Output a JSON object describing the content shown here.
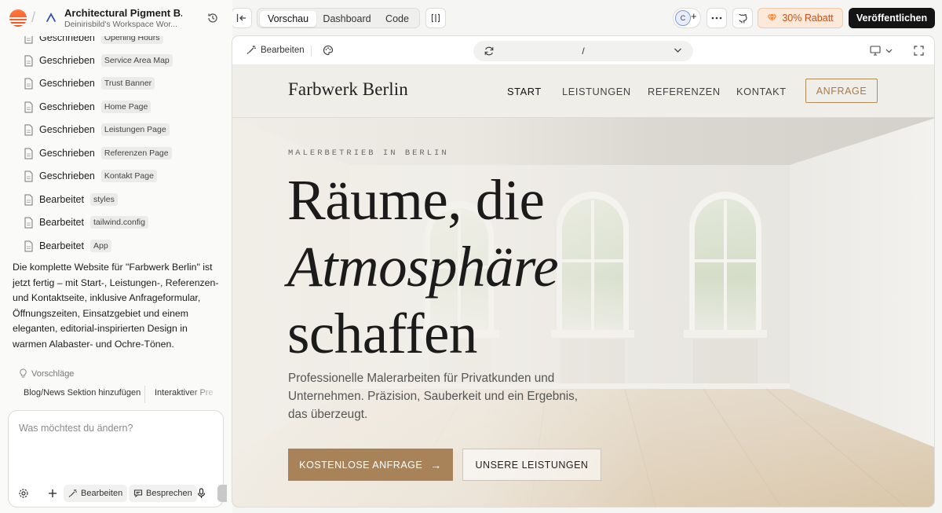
{
  "sidebar": {
    "project_title": "Architectural Pigment B...",
    "project_subtitle": "Deinirisbild's Workspace Wor...",
    "files": [
      {
        "action": "Geschrieben",
        "name": "Opening Hours"
      },
      {
        "action": "Geschrieben",
        "name": "Service Area Map"
      },
      {
        "action": "Geschrieben",
        "name": "Trust Banner"
      },
      {
        "action": "Geschrieben",
        "name": "Home Page"
      },
      {
        "action": "Geschrieben",
        "name": "Leistungen Page"
      },
      {
        "action": "Geschrieben",
        "name": "Referenzen Page"
      },
      {
        "action": "Geschrieben",
        "name": "Kontakt Page"
      },
      {
        "action": "Bearbeitet",
        "name": "styles"
      },
      {
        "action": "Bearbeitet",
        "name": "tailwind.config"
      },
      {
        "action": "Bearbeitet",
        "name": "App"
      }
    ],
    "summary": "Die komplette Website für \"Farbwerk Berlin\" ist jetzt fertig – mit Start-, Leistungen-, Referenzen- und Kontaktseite, inklusive Anfrageformular, Öffnungszeiten, Einsatzgebiet und einem eleganten, editorial-inspirierten Design in warmen Alabaster- und Ochre-Tönen.",
    "suggestions_label": "Vorschläge",
    "suggestions": [
      "Blog/News Sektion hinzufügen",
      "Interaktiver Pre"
    ],
    "composer_placeholder": "Was möchtest du ändern?",
    "composer_edit": "Bearbeiten",
    "composer_discuss": "Besprechen"
  },
  "toolbar": {
    "tabs": [
      "Vorschau",
      "Dashboard",
      "Code"
    ],
    "active_tab": "Vorschau",
    "avatar_initial": "C",
    "promo": "30% Rabatt",
    "publish": "Veröffentlichen"
  },
  "preview": {
    "edit_label": "Bearbeiten",
    "url": "/"
  },
  "site": {
    "brand": "Farbwerk Berlin",
    "nav": [
      "START",
      "LEISTUNGEN",
      "REFERENZEN",
      "KONTAKT"
    ],
    "nav_cta": "ANFRAGE",
    "kicker": "MALERBETRIEB IN BERLIN",
    "headline_1": "Räume, die",
    "headline_2": "Atmosphäre",
    "headline_3": "schaffen",
    "body": "Professionelle Malerarbeiten für Privatkunden und Unternehmen. Präzision, Sauberkeit und ein Ergebnis, das überzeugt.",
    "cta_primary": "KOSTENLOSE ANFRAGE",
    "cta_primary_arrow": "→",
    "cta_secondary": "UNSERE LEISTUNGEN"
  },
  "colors": {
    "accent_ochre": "#a8835a",
    "promo_orange": "#c5511a",
    "publish_black": "#141414"
  },
  "icons": [
    "app-logo",
    "project-icon",
    "history-icon",
    "file-icon",
    "lightbulb-icon",
    "settings-icon",
    "plus-icon",
    "sparkle-icon",
    "chat-icon",
    "mic-icon",
    "collapse-sidebar-icon",
    "split-view-icon",
    "more-icon",
    "github-icon",
    "gem-icon",
    "palette-icon",
    "refresh-icon",
    "chevron-down-icon",
    "monitor-icon",
    "fullscreen-icon",
    "arrow-right-icon"
  ]
}
